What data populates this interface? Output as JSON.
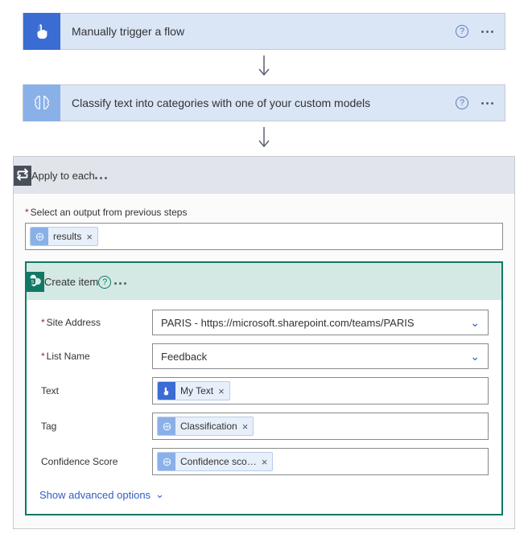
{
  "steps": {
    "trigger": {
      "title": "Manually trigger a flow"
    },
    "classify": {
      "title": "Classify text into categories with one of your custom models"
    }
  },
  "apply": {
    "title": "Apply to each",
    "output_label": "Select an output from previous steps",
    "output_token": "results"
  },
  "create": {
    "title": "Create item",
    "fields": {
      "site": {
        "label": "Site Address",
        "value": "PARIS - https://microsoft.sharepoint.com/teams/PARIS"
      },
      "list": {
        "label": "List Name",
        "value": "Feedback"
      },
      "text": {
        "label": "Text",
        "token": "My Text"
      },
      "tag": {
        "label": "Tag",
        "token": "Classification"
      },
      "conf": {
        "label": "Confidence Score",
        "token": "Confidence sco…"
      }
    },
    "advanced": "Show advanced options"
  },
  "glyphs": {
    "help": "?",
    "close": "×",
    "chevron": "⌄"
  }
}
